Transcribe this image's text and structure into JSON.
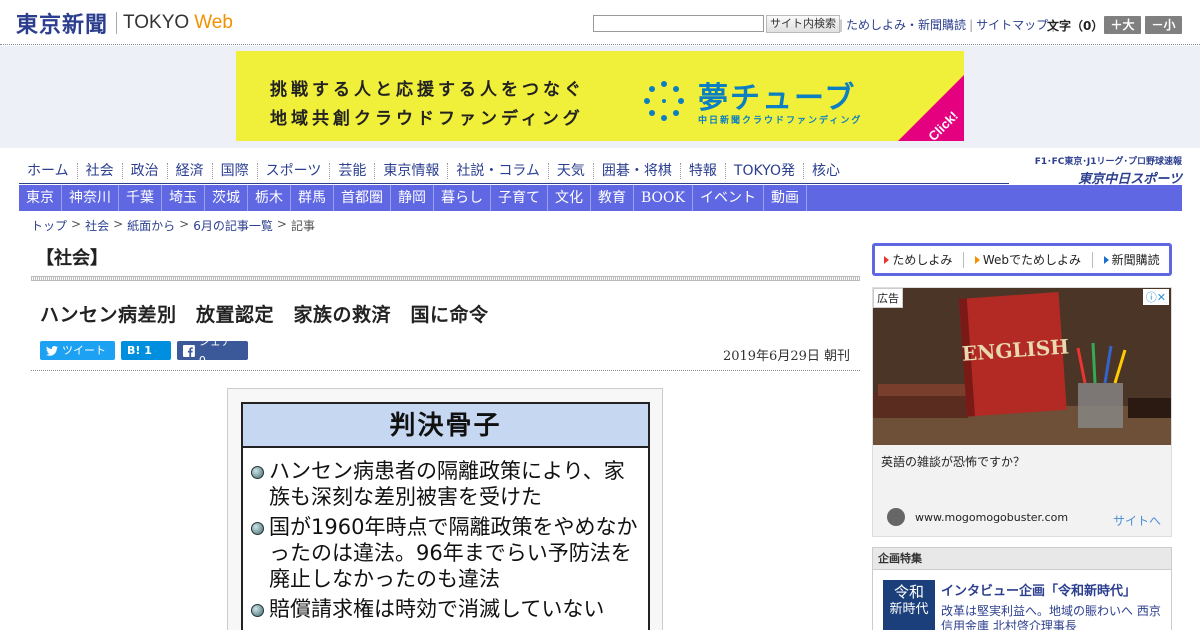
{
  "header": {
    "logo_jp": "東京新聞",
    "logo_en_1": "TOKYO",
    "logo_en_2": "Web",
    "search_placeholder": "",
    "search_button": "サイト内検索",
    "links": [
      "ためしよみ・新聞購読",
      "サイトマップ"
    ],
    "font_size_label": "文字（0）",
    "font_bigger": "＋大",
    "font_smaller": "－小"
  },
  "banner": {
    "line1": "挑戦する人と応援する人をつなぐ",
    "line2": "地域共創クラウドファンディング",
    "name": "夢チューブ",
    "sub": "中日新聞クラウドファンディング",
    "click": "Click!"
  },
  "nav_primary": [
    "ホーム",
    "社会",
    "政治",
    "経済",
    "国際",
    "スポーツ",
    "芸能",
    "東京情報",
    "社説・コラム",
    "天気",
    "囲碁・将棋",
    "特報",
    "TOKYO発",
    "核心"
  ],
  "chunichi": {
    "top": "F1･FC東京･J1リーグ･プロ野球速報",
    "logo": "東京中日スポーツ"
  },
  "nav_secondary": [
    "東京",
    "神奈川",
    "千葉",
    "埼玉",
    "茨城",
    "栃木",
    "群馬",
    "首都圏",
    "静岡",
    "暮らし",
    "子育て",
    "文化",
    "教育",
    "BOOK",
    "イベント",
    "動画"
  ],
  "breadcrumb": [
    "トップ",
    "社会",
    "紙面から",
    "6月の記事一覧",
    "記事"
  ],
  "article": {
    "section": "【社会】",
    "headline": "ハンセン病差別　放置認定　家族の救済　国に命令",
    "share_tweet": "ツイート",
    "share_hatena": "B! 1",
    "share_facebook": "シェア 0",
    "date": "2019年6月29日 朝刊"
  },
  "figure": {
    "title": "判決骨子",
    "items": [
      "ハンセン病患者の隔離政策により、家族も深刻な差別被害を受けた",
      "国が1960年時点で隔離政策をやめなかったのは違法。96年までらい予防法を廃止しなかったのも違法",
      "賠償請求権は時効で消滅していない"
    ]
  },
  "sidebar": {
    "subscribe_links": [
      "ためしよみ",
      "Webでためしよみ",
      "新聞購読"
    ],
    "ad": {
      "label": "広告",
      "text": "英語の雑談が恐怖ですか？",
      "domain": "www.mogomogobuster.com",
      "link": "サイトへ",
      "book_word": "ENGLISH"
    },
    "kikaku": {
      "header": "企画特集",
      "thumb_line1": "令和",
      "thumb_line2": "新時代",
      "title": "インタビュー企画「令和新時代」",
      "desc": "改革は堅実利益へ。地域の賑わいへ 西京信用金庫 北村啓介理事長"
    }
  },
  "colors": {
    "brand_navy": "#2c3f8f",
    "nav_secondary_bg": "#5f67e3",
    "banner_yellow": "#f0ef3a",
    "banner_blue": "#0a7fc2",
    "accent_orange": "#f29100",
    "twitter": "#1da1f2",
    "hatena": "#008fde",
    "facebook": "#3b5998"
  }
}
